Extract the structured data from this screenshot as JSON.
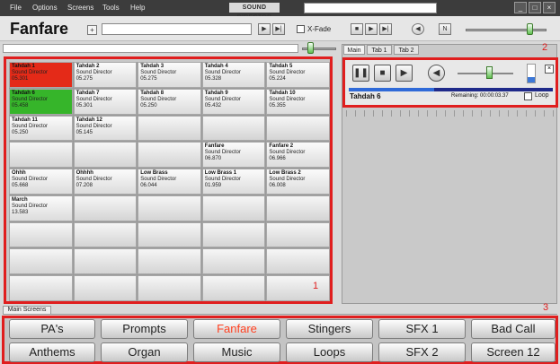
{
  "menu": {
    "items": [
      "File",
      "Options",
      "Screens",
      "Tools",
      "Help"
    ],
    "logo": "SOUND DIRECTOR",
    "window_controls": [
      "_",
      "□",
      "×"
    ]
  },
  "toolbar": {
    "title": "Fanfare",
    "add_label": "+",
    "xfade_label": "X-Fade",
    "nav_left": "▶",
    "nav_right": "▶|"
  },
  "grid": {
    "subtitle": "Sound Director",
    "rows": [
      [
        {
          "title": "Tahdah 1",
          "sub": "Sound Director",
          "time": "05.301",
          "state": "red"
        },
        {
          "title": "Tahdah 2",
          "sub": "Sound Director",
          "time": "05.275",
          "state": ""
        },
        {
          "title": "Tahdah 3",
          "sub": "Sound Director",
          "time": "05.275",
          "state": ""
        },
        {
          "title": "Tahdah 4",
          "sub": "Sound Director",
          "time": "05.328",
          "state": ""
        },
        {
          "title": "Tahdah 5",
          "sub": "Sound Director",
          "time": "05.224",
          "state": ""
        }
      ],
      [
        {
          "title": "Tahdah 6",
          "sub": "Sound Director",
          "time": "05.458",
          "state": "green"
        },
        {
          "title": "Tahdah 7",
          "sub": "Sound Director",
          "time": "05.301",
          "state": ""
        },
        {
          "title": "Tahdah 8",
          "sub": "Sound Director",
          "time": "05.250",
          "state": ""
        },
        {
          "title": "Tahdah 9",
          "sub": "Sound Director",
          "time": "05.432",
          "state": ""
        },
        {
          "title": "Tahdah 10",
          "sub": "Sound Director",
          "time": "05.355",
          "state": ""
        }
      ],
      [
        {
          "title": "Tahdah 11",
          "sub": "Sound Director",
          "time": "05.250",
          "state": ""
        },
        {
          "title": "Tahdah 12",
          "sub": "Sound Director",
          "time": "05.145",
          "state": ""
        },
        {
          "title": "",
          "sub": "",
          "time": "",
          "state": "empty"
        },
        {
          "title": "",
          "sub": "",
          "time": "",
          "state": "empty"
        },
        {
          "title": "",
          "sub": "",
          "time": "",
          "state": "empty"
        }
      ],
      [
        {
          "title": "",
          "sub": "",
          "time": "",
          "state": "empty"
        },
        {
          "title": "",
          "sub": "",
          "time": "",
          "state": "empty"
        },
        {
          "title": "",
          "sub": "",
          "time": "",
          "state": "empty"
        },
        {
          "title": "Fanfare",
          "sub": "Sound Director",
          "time": "06.870",
          "state": ""
        },
        {
          "title": "Fanfare 2",
          "sub": "Sound Director",
          "time": "06.966",
          "state": ""
        }
      ],
      [
        {
          "title": "Ohhh",
          "sub": "Sound Director",
          "time": "05.668",
          "state": ""
        },
        {
          "title": "Ohhhh",
          "sub": "Sound Director",
          "time": "07.208",
          "state": ""
        },
        {
          "title": "Low Brass",
          "sub": "Sound Director",
          "time": "06.044",
          "state": ""
        },
        {
          "title": "Low Brass 1",
          "sub": "Sound Director",
          "time": "01.959",
          "state": ""
        },
        {
          "title": "Low Brass 2",
          "sub": "Sound Director",
          "time": "06.008",
          "state": ""
        }
      ],
      [
        {
          "title": "March",
          "sub": "Sound Director",
          "time": "13.583",
          "state": ""
        },
        {
          "title": "",
          "sub": "",
          "time": "",
          "state": "empty"
        },
        {
          "title": "",
          "sub": "",
          "time": "",
          "state": "empty"
        },
        {
          "title": "",
          "sub": "",
          "time": "",
          "state": "empty"
        },
        {
          "title": "",
          "sub": "",
          "time": "",
          "state": "empty"
        }
      ],
      [
        {
          "title": "",
          "sub": "",
          "time": "",
          "state": "empty"
        },
        {
          "title": "",
          "sub": "",
          "time": "",
          "state": "empty"
        },
        {
          "title": "",
          "sub": "",
          "time": "",
          "state": "empty"
        },
        {
          "title": "",
          "sub": "",
          "time": "",
          "state": "empty"
        },
        {
          "title": "",
          "sub": "",
          "time": "",
          "state": "empty"
        }
      ],
      [
        {
          "title": "",
          "sub": "",
          "time": "",
          "state": "empty"
        },
        {
          "title": "",
          "sub": "",
          "time": "",
          "state": "empty"
        },
        {
          "title": "",
          "sub": "",
          "time": "",
          "state": "empty"
        },
        {
          "title": "",
          "sub": "",
          "time": "",
          "state": "empty"
        },
        {
          "title": "",
          "sub": "",
          "time": "",
          "state": "empty"
        }
      ],
      [
        {
          "title": "",
          "sub": "",
          "time": "",
          "state": "empty"
        },
        {
          "title": "",
          "sub": "",
          "time": "",
          "state": "empty"
        },
        {
          "title": "",
          "sub": "",
          "time": "",
          "state": "empty"
        },
        {
          "title": "",
          "sub": "",
          "time": "",
          "state": "empty"
        },
        {
          "title": "",
          "sub": "",
          "time": "",
          "state": "empty"
        }
      ]
    ]
  },
  "annotations": {
    "grid": "1",
    "player": "2",
    "screens": "3"
  },
  "right_panel": {
    "tabs": [
      "Main",
      "Tab 1",
      "Tab 2"
    ],
    "player": {
      "now_playing": "Tahdah 6",
      "remaining": "Remaining: 00:00:03.37",
      "loop_label": "Loop",
      "close_label": "×",
      "progress": 0.42,
      "volume": 0.65
    }
  },
  "main_screens_tab": "Main Screens",
  "screens": {
    "row1": [
      "PA's",
      "Prompts",
      "Fanfare",
      "Stingers",
      "SFX 1",
      "Bad Call"
    ],
    "row2": [
      "Anthems",
      "Organ",
      "Music",
      "Loops",
      "SFX 2",
      "Screen 12"
    ],
    "active": "Fanfare"
  },
  "colors": {
    "highlight": "#e01e1e",
    "playing": "#36b52a",
    "cued": "#e42a18",
    "active_text": "#ff4020"
  }
}
